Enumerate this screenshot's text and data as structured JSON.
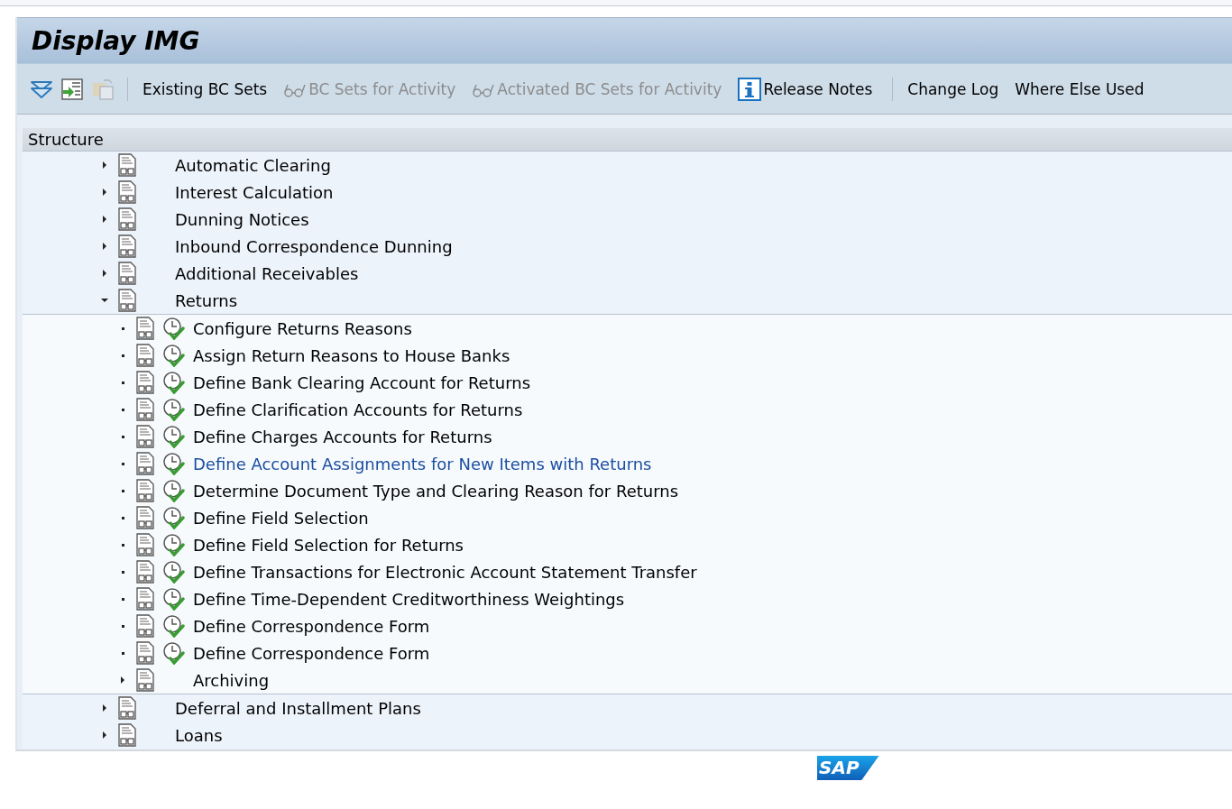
{
  "window": {
    "title": "Display IMG"
  },
  "toolbar": [
    {
      "kind": "expand",
      "disabled": false
    },
    {
      "kind": "import",
      "disabled": false
    },
    {
      "kind": "paste",
      "disabled": true
    },
    {
      "kind": "separator"
    },
    {
      "kind": "text",
      "label": "Existing BC Sets",
      "disabled": false
    },
    {
      "kind": "glasses",
      "label": "BC Sets for Activity",
      "disabled": true
    },
    {
      "kind": "glasses",
      "label": "Activated BC Sets for Activity",
      "disabled": true
    },
    {
      "kind": "info",
      "label": "Release Notes",
      "disabled": false
    },
    {
      "kind": "separator"
    },
    {
      "kind": "text",
      "label": "Change Log",
      "disabled": false
    },
    {
      "kind": "text",
      "label": "Where Else Used",
      "disabled": false
    }
  ],
  "structure": {
    "header": "Structure",
    "items": [
      {
        "label": "Automatic Clearing",
        "expanded": false
      },
      {
        "label": "Interest Calculation",
        "expanded": false
      },
      {
        "label": "Dunning Notices",
        "expanded": false
      },
      {
        "label": "Inbound Correspondence Dunning",
        "expanded": false
      },
      {
        "label": "Additional Receivables",
        "expanded": false
      },
      {
        "label": "Returns",
        "expanded": true,
        "children": [
          {
            "kind": "activity",
            "label": "Configure Returns Reasons",
            "selected": false
          },
          {
            "kind": "activity",
            "label": "Assign Return Reasons to House Banks",
            "selected": false
          },
          {
            "kind": "activity",
            "label": "Define Bank Clearing Account for Returns",
            "selected": false
          },
          {
            "kind": "activity",
            "label": "Define Clarification Accounts for Returns",
            "selected": false
          },
          {
            "kind": "activity",
            "label": "Define Charges Accounts for Returns",
            "selected": false
          },
          {
            "kind": "activity",
            "label": "Define Account Assignments for New Items with Returns",
            "selected": true
          },
          {
            "kind": "activity",
            "label": "Determine Document Type and Clearing Reason for Returns",
            "selected": false
          },
          {
            "kind": "activity",
            "label": "Define Field Selection",
            "selected": false
          },
          {
            "kind": "activity",
            "label": "Define Field Selection for Returns",
            "selected": false
          },
          {
            "kind": "activity",
            "label": "Define Transactions for Electronic Account Statement Transfer",
            "selected": false
          },
          {
            "kind": "activity",
            "label": "Define Time-Dependent Creditworthiness Weightings",
            "selected": false
          },
          {
            "kind": "activity",
            "label": "Define Correspondence Form",
            "selected": false
          },
          {
            "kind": "activity",
            "label": "Define Correspondence Form",
            "selected": false
          },
          {
            "kind": "node",
            "label": "Archiving",
            "expanded": false
          }
        ]
      },
      {
        "label": "Deferral and Installment Plans",
        "expanded": false
      },
      {
        "label": "Loans",
        "expanded": false
      }
    ]
  },
  "footer": {
    "logo_text": "SAP"
  }
}
